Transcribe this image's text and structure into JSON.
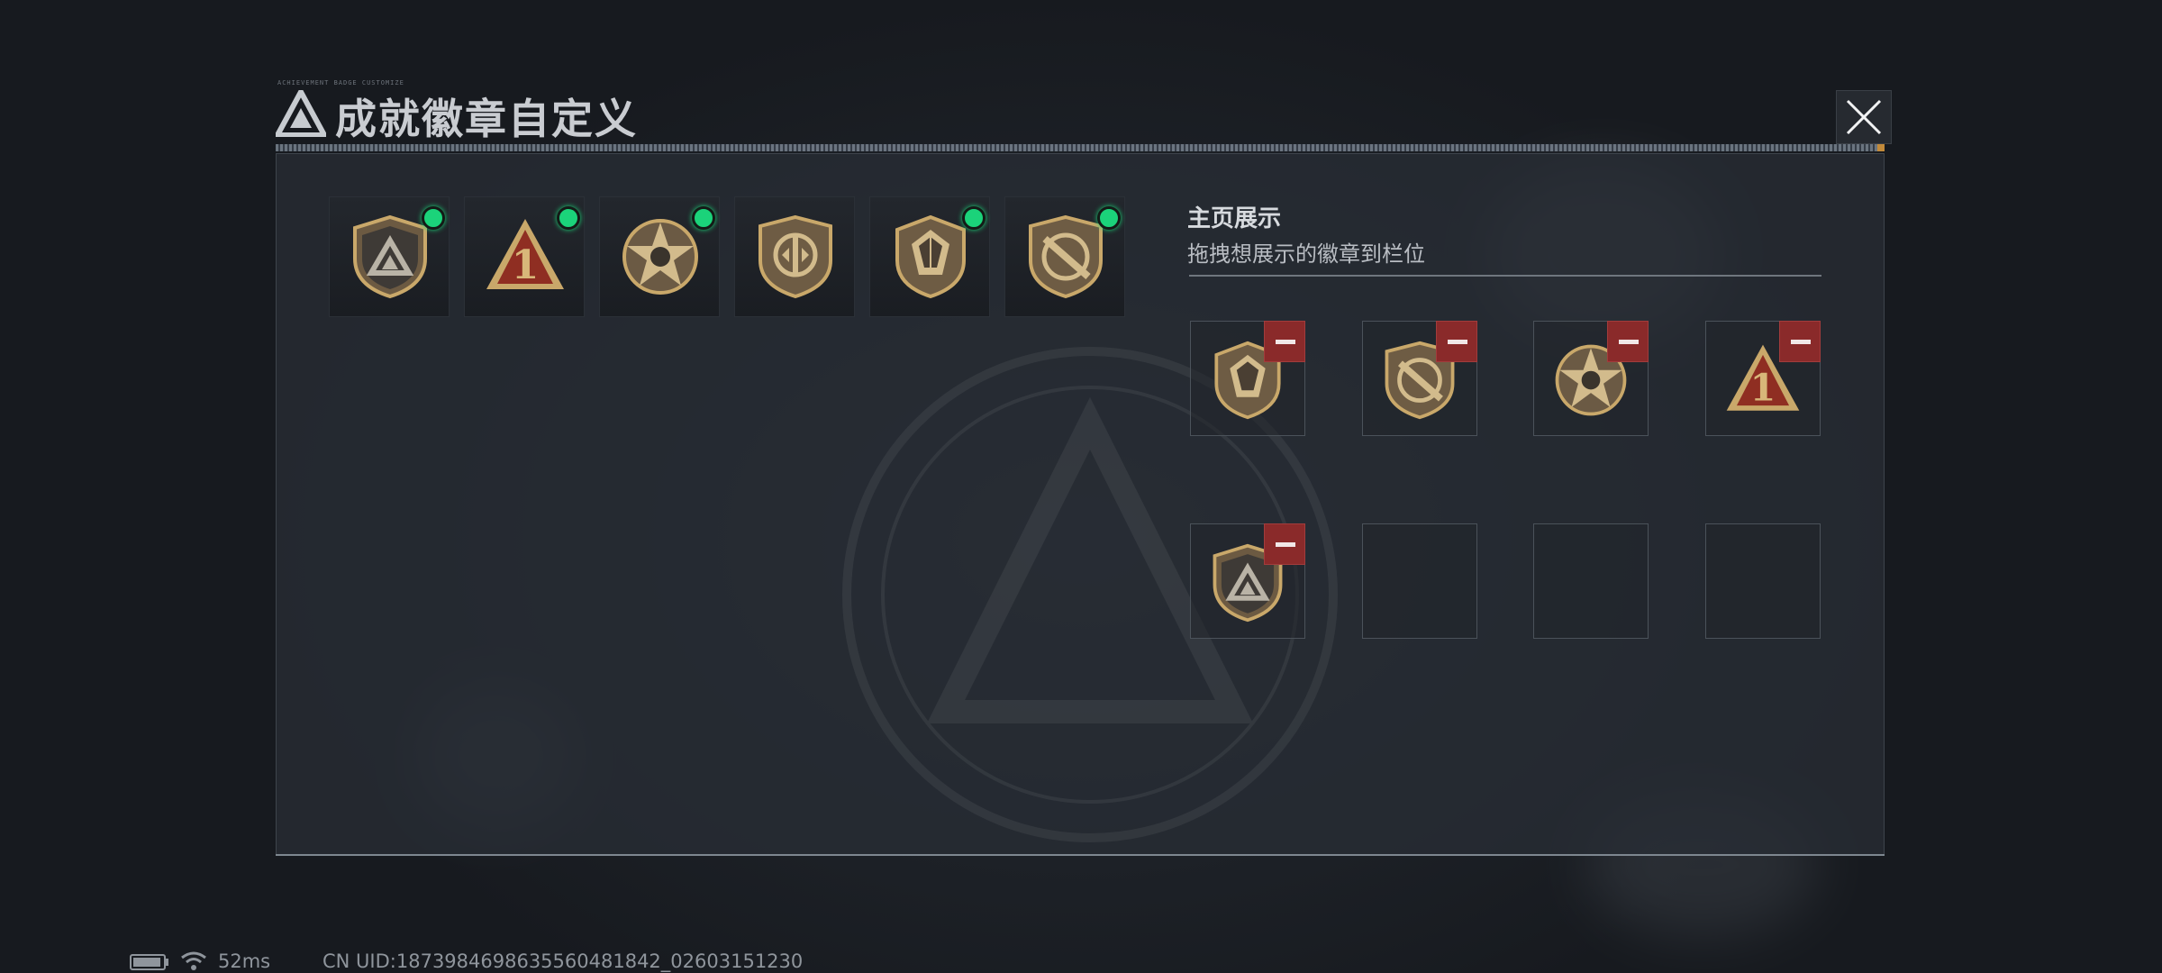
{
  "dialog": {
    "title": "成就徽章自定义",
    "title_small_print": "ACHIEVEMENT BADGE CUSTOMIZE",
    "close_icon": "close-icon"
  },
  "collection": {
    "badges": [
      {
        "icon": "triangle-shield-badge-icon",
        "equipped": true
      },
      {
        "icon": "number-one-triangle-badge-icon",
        "equipped": true
      },
      {
        "icon": "star-circle-badge-icon",
        "equipped": true
      },
      {
        "icon": "split-shield-badge-icon",
        "equipped": false
      },
      {
        "icon": "crystal-shield-badge-icon",
        "equipped": true
      },
      {
        "icon": "blade-shield-badge-icon",
        "equipped": true
      }
    ]
  },
  "showcase": {
    "title": "主页展示",
    "subtitle": "拖拽想展示的徽章到栏位",
    "slots": [
      {
        "badge": "crystal-shield-badge-icon",
        "removable": true
      },
      {
        "badge": "blade-shield-badge-icon",
        "removable": true
      },
      {
        "badge": "star-circle-badge-icon",
        "removable": true
      },
      {
        "badge": "number-one-triangle-badge-icon",
        "removable": true
      },
      {
        "badge": "triangle-shield-badge-icon",
        "removable": true
      },
      {
        "badge": null,
        "removable": false
      },
      {
        "badge": null,
        "removable": false
      },
      {
        "badge": null,
        "removable": false
      }
    ]
  },
  "status_bar": {
    "ping": "52ms",
    "uid": "CN UID:1873984698635560481842_02603151230"
  },
  "colors": {
    "equipped_dot": "#1bd37a",
    "remove_button": "#8a2a2a",
    "badge_gold": "#c9a86a",
    "badge_red": "#8f2e22"
  }
}
